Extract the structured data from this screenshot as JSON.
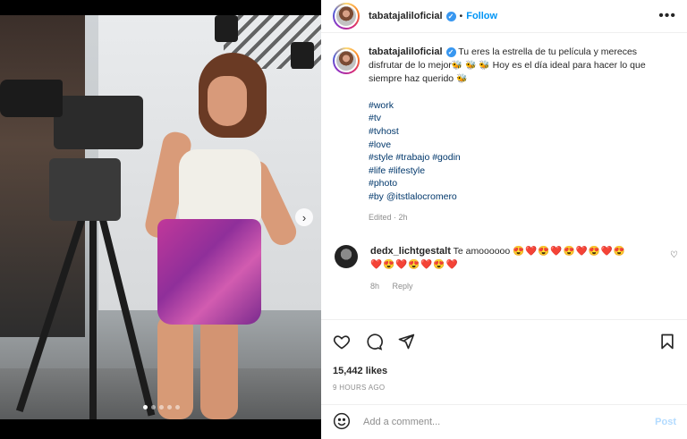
{
  "post": {
    "username": "tabatajaliloficial",
    "verified_mark": "✓",
    "separator": "•",
    "follow_label": "Follow",
    "more_label": "•••"
  },
  "caption": {
    "username": "tabatajaliloficial",
    "text_part1": "Tu eres la estrella de tu película y mereces disfrutar de lo mejor",
    "bees1": "🐝 🐝 🐝",
    "text_part2": "Hoy es el día ideal para hacer lo que siempre haz querido",
    "bees2": "🐝",
    "hashtags": [
      "#work",
      "#tv",
      "#tvhost",
      "#love",
      "#style #trabajo #godin",
      "#life #lifestyle",
      "#photo",
      "#by @itstlalocromero"
    ],
    "edited": "Edited · 2h"
  },
  "comment": {
    "username": "dedx_lichtgestalt",
    "text": "Te amoooooo",
    "emojis_line1": "😍❤️😍❤️😍❤️😍❤️😍",
    "emojis_line2": "❤️😍❤️😍❤️😍❤️",
    "time": "8h",
    "reply_label": "Reply"
  },
  "actions": {
    "likes": "15,442 likes",
    "timestamp": "9 HOURS AGO"
  },
  "add_comment": {
    "placeholder": "Add a comment...",
    "post_label": "Post"
  },
  "carousel": {
    "next_label": "›",
    "slide_count": 5,
    "active_index": 0
  },
  "colors": {
    "accent": "#0095f6",
    "verified": "#3897f0",
    "muted": "#8e8e8e",
    "hashtag": "#00376b"
  },
  "icons": [
    "heart-icon",
    "comment-icon",
    "share-icon",
    "bookmark-icon",
    "emoji-icon",
    "more-icon",
    "chevron-right-icon",
    "verified-icon"
  ]
}
